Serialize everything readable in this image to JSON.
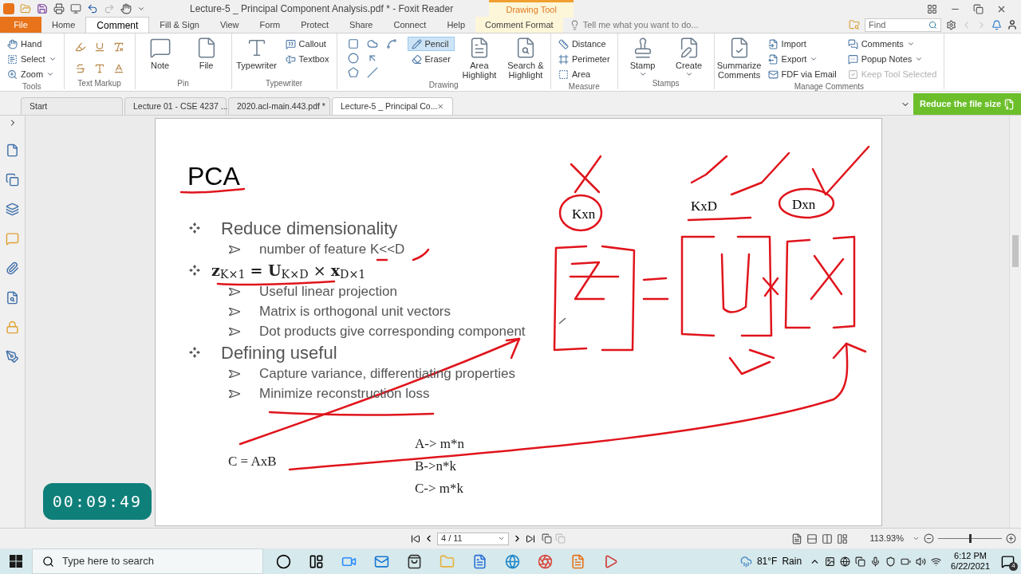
{
  "title_bar": {
    "title": "Lecture-5 _ Principal Component Analysis.pdf * - Foxit Reader",
    "context_tab": "Drawing Tool"
  },
  "menu_tabs": [
    {
      "label": "File",
      "selected": false,
      "kind": "file"
    },
    {
      "label": "Home",
      "selected": false,
      "kind": "tab"
    },
    {
      "label": "Comment",
      "selected": true,
      "kind": "tab"
    },
    {
      "label": "Fill & Sign",
      "selected": false,
      "kind": "tab"
    },
    {
      "label": "View",
      "selected": false,
      "kind": "tab"
    },
    {
      "label": "Form",
      "selected": false,
      "kind": "tab"
    },
    {
      "label": "Protect",
      "selected": false,
      "kind": "tab"
    },
    {
      "label": "Share",
      "selected": false,
      "kind": "tab"
    },
    {
      "label": "Connect",
      "selected": false,
      "kind": "tab"
    },
    {
      "label": "Help",
      "selected": false,
      "kind": "tab"
    },
    {
      "label": "Comment Format",
      "selected": false,
      "kind": "context"
    }
  ],
  "tell_me": {
    "placeholder": "Tell me what you want to do..."
  },
  "find": {
    "placeholder": "Find"
  },
  "ribbon": [
    {
      "label": "Tools",
      "items": [
        {
          "label": "Hand",
          "kind": "small"
        },
        {
          "label": "Select",
          "kind": "small",
          "dropdown": true
        },
        {
          "label": "Zoom",
          "kind": "small",
          "dropdown": true
        }
      ]
    },
    {
      "label": "Text Markup",
      "items": [
        {
          "kind": "icon"
        },
        {
          "kind": "icon"
        },
        {
          "kind": "icon"
        },
        {
          "kind": "icon"
        },
        {
          "kind": "icon"
        },
        {
          "kind": "icon"
        }
      ]
    },
    {
      "label": "Pin",
      "items": [
        {
          "label": "Note",
          "kind": "large"
        },
        {
          "label": "File",
          "kind": "large"
        }
      ]
    },
    {
      "label": "Typewriter",
      "items": [
        {
          "label": "Typewriter",
          "kind": "large"
        },
        {
          "label": "Callout",
          "kind": "small"
        },
        {
          "label": "Textbox",
          "kind": "small"
        }
      ]
    },
    {
      "label": "Drawing",
      "items": [
        {
          "kind": "icon"
        },
        {
          "kind": "icon"
        },
        {
          "kind": "icon"
        },
        {
          "kind": "icon"
        },
        {
          "kind": "icon"
        },
        {
          "kind": "icon"
        },
        {
          "kind": "icon"
        },
        {
          "label": "Pencil",
          "kind": "small",
          "selected": true
        },
        {
          "label": "Eraser",
          "kind": "small",
          "selected": false
        },
        {
          "label": "Area Highlight",
          "kind": "large"
        },
        {
          "label": "Search & Highlight",
          "kind": "large"
        }
      ]
    },
    {
      "label": "Measure",
      "items": [
        {
          "label": "Distance",
          "kind": "small"
        },
        {
          "label": "Perimeter",
          "kind": "small"
        },
        {
          "label": "Area",
          "kind": "small"
        }
      ]
    },
    {
      "label": "Stamps",
      "items": [
        {
          "label": "Stamp",
          "kind": "large",
          "dropdown": true
        },
        {
          "label": "Create",
          "kind": "large",
          "dropdown": true
        }
      ]
    },
    {
      "label": "Manage Comments",
      "items": [
        {
          "label": "Summarize Comments",
          "kind": "large"
        },
        {
          "label": "Import",
          "kind": "small"
        },
        {
          "label": "Export",
          "kind": "small",
          "dropdown": true
        },
        {
          "label": "FDF via Email",
          "kind": "small"
        },
        {
          "label": "Comments",
          "kind": "small",
          "dropdown": true
        },
        {
          "label": "Popup Notes",
          "kind": "small",
          "dropdown": true
        },
        {
          "label": "Keep Tool Selected",
          "kind": "check",
          "checked": true,
          "disabled": true
        }
      ]
    }
  ],
  "doc_tabs": [
    {
      "label": "Start",
      "selected": false
    },
    {
      "label": "Lecture 01 - CSE 4237 ...",
      "selected": false
    },
    {
      "label": "2020.acl-main.443.pdf *",
      "selected": false
    },
    {
      "label": "Lecture-5 _ Principal Co...",
      "selected": true
    }
  ],
  "reduce_button": "Reduce the file size",
  "slide": {
    "title": "PCA",
    "bullets": [
      {
        "text": "Reduce dimensionality",
        "kind": "text",
        "children": [
          {
            "text": "number of feature K<<D"
          }
        ]
      },
      {
        "text": "**z**$_{K×1}$ **= U**$_{K×D}$ × **x**$_{D×1}$",
        "kind": "formula",
        "children": [
          {
            "text": "Useful linear projection"
          },
          {
            "text": "Matrix is orthogonal unit vectors"
          },
          {
            "text": "Dot products give corresponding component"
          }
        ]
      },
      {
        "text": "Defining useful",
        "kind": "text",
        "children": [
          {
            "text": "Capture variance, differentiating properties"
          },
          {
            "text": "Minimize reconstruction loss"
          }
        ]
      }
    ],
    "equation_left": "C = AxB",
    "equations_right": [
      "A-> m*n",
      "B->n*k",
      "C-> m*k"
    ],
    "ink_labels": [
      "Kxn",
      "KxD",
      "Dxn"
    ]
  },
  "timer": "00:09:49",
  "status_bar": {
    "page": "4 / 11",
    "zoom": "113.93%",
    "zoom_slider": {
      "level": 0.5
    }
  },
  "taskbar": {
    "search_placeholder": "Type here to search",
    "temperature": "81°F",
    "weather": "Rain",
    "time": "6:12 PM",
    "date": "6/22/2021",
    "notifications": "4"
  }
}
